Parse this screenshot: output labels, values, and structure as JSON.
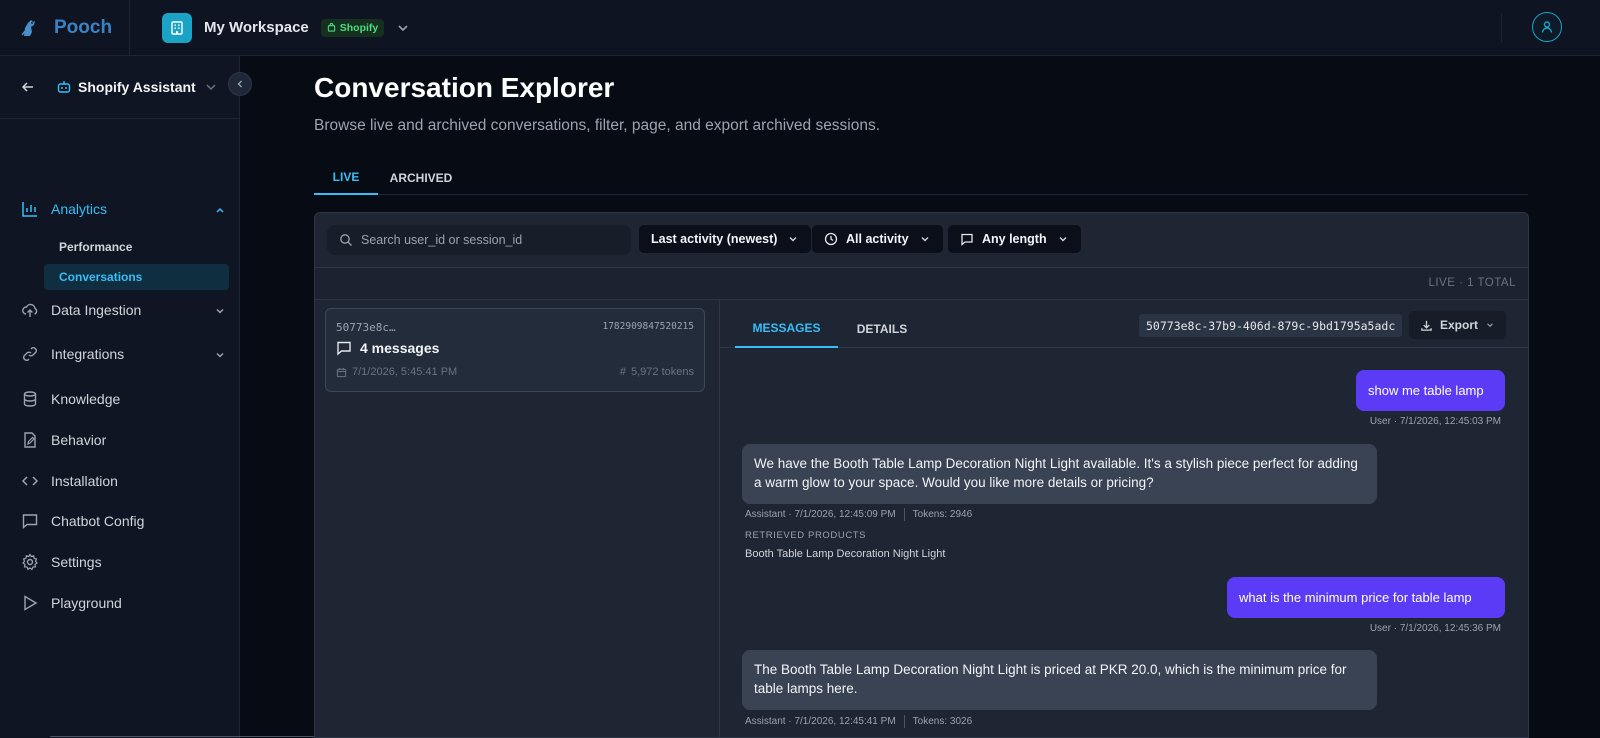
{
  "app": {
    "name": "Pooch"
  },
  "workspace": {
    "name": "My Workspace",
    "badge": "Shopify"
  },
  "sidebar": {
    "assistant": "Shopify Assistant",
    "items": [
      {
        "label": "Analytics"
      },
      {
        "label": "Data Ingestion"
      },
      {
        "label": "Integrations"
      },
      {
        "label": "Knowledge"
      },
      {
        "label": "Behavior"
      },
      {
        "label": "Installation"
      },
      {
        "label": "Chatbot Config"
      },
      {
        "label": "Settings"
      },
      {
        "label": "Playground"
      }
    ],
    "analytics_sub": [
      {
        "label": "Performance"
      },
      {
        "label": "Conversations"
      }
    ]
  },
  "page": {
    "title": "Conversation Explorer",
    "subtitle": "Browse live and archived conversations, filter, page, and export archived sessions.",
    "tabs": [
      "LIVE",
      "ARCHIVED"
    ]
  },
  "filters": {
    "search_placeholder": "Search user_id or session_id",
    "sort": "Last activity (newest)",
    "activity": "All activity",
    "length": "Any length",
    "summary": "LIVE · 1 TOTAL"
  },
  "conversation": {
    "session_short": "50773e8c…",
    "timestamp": "1782909847520215",
    "messages_count": "4 messages",
    "date": "7/1/2026, 5:45:41 PM",
    "tokens": "5,972 tokens"
  },
  "detail": {
    "tabs": [
      "MESSAGES",
      "DETAILS"
    ],
    "session_id": "50773e8c-37b9-406d-879c-9bd1795a5adc",
    "export_label": "Export",
    "retrieved_heading": "RETRIEVED PRODUCTS",
    "messages": [
      {
        "role": "user",
        "text": "show me table lamp",
        "meta": "User · 7/1/2026, 12:45:03 PM"
      },
      {
        "role": "assistant",
        "text": "We have the Booth Table Lamp Decoration Night Light available. It's a stylish piece perfect for adding a warm glow to your space. Would you like more details or pricing?",
        "meta": "Assistant · 7/1/2026, 12:45:09 PM",
        "tokens": "Tokens: 2946",
        "retrieved": "Booth Table Lamp Decoration Night Light"
      },
      {
        "role": "user",
        "text": "what is the minimum price for table lamp",
        "meta": "User · 7/1/2026, 12:45:36 PM"
      },
      {
        "role": "assistant",
        "text": "The Booth Table Lamp Decoration Night Light is priced at PKR 20.0, which is the minimum price for table lamps here.",
        "meta": "Assistant · 7/1/2026, 12:45:41 PM",
        "tokens": "Tokens: 3026"
      }
    ]
  },
  "colors": {
    "accent": "#38bdf8",
    "user_bubble": "#5b3bf5",
    "bot_bubble": "#394354",
    "brand": "#3b82c4",
    "shopify_green": "#4ade80"
  }
}
